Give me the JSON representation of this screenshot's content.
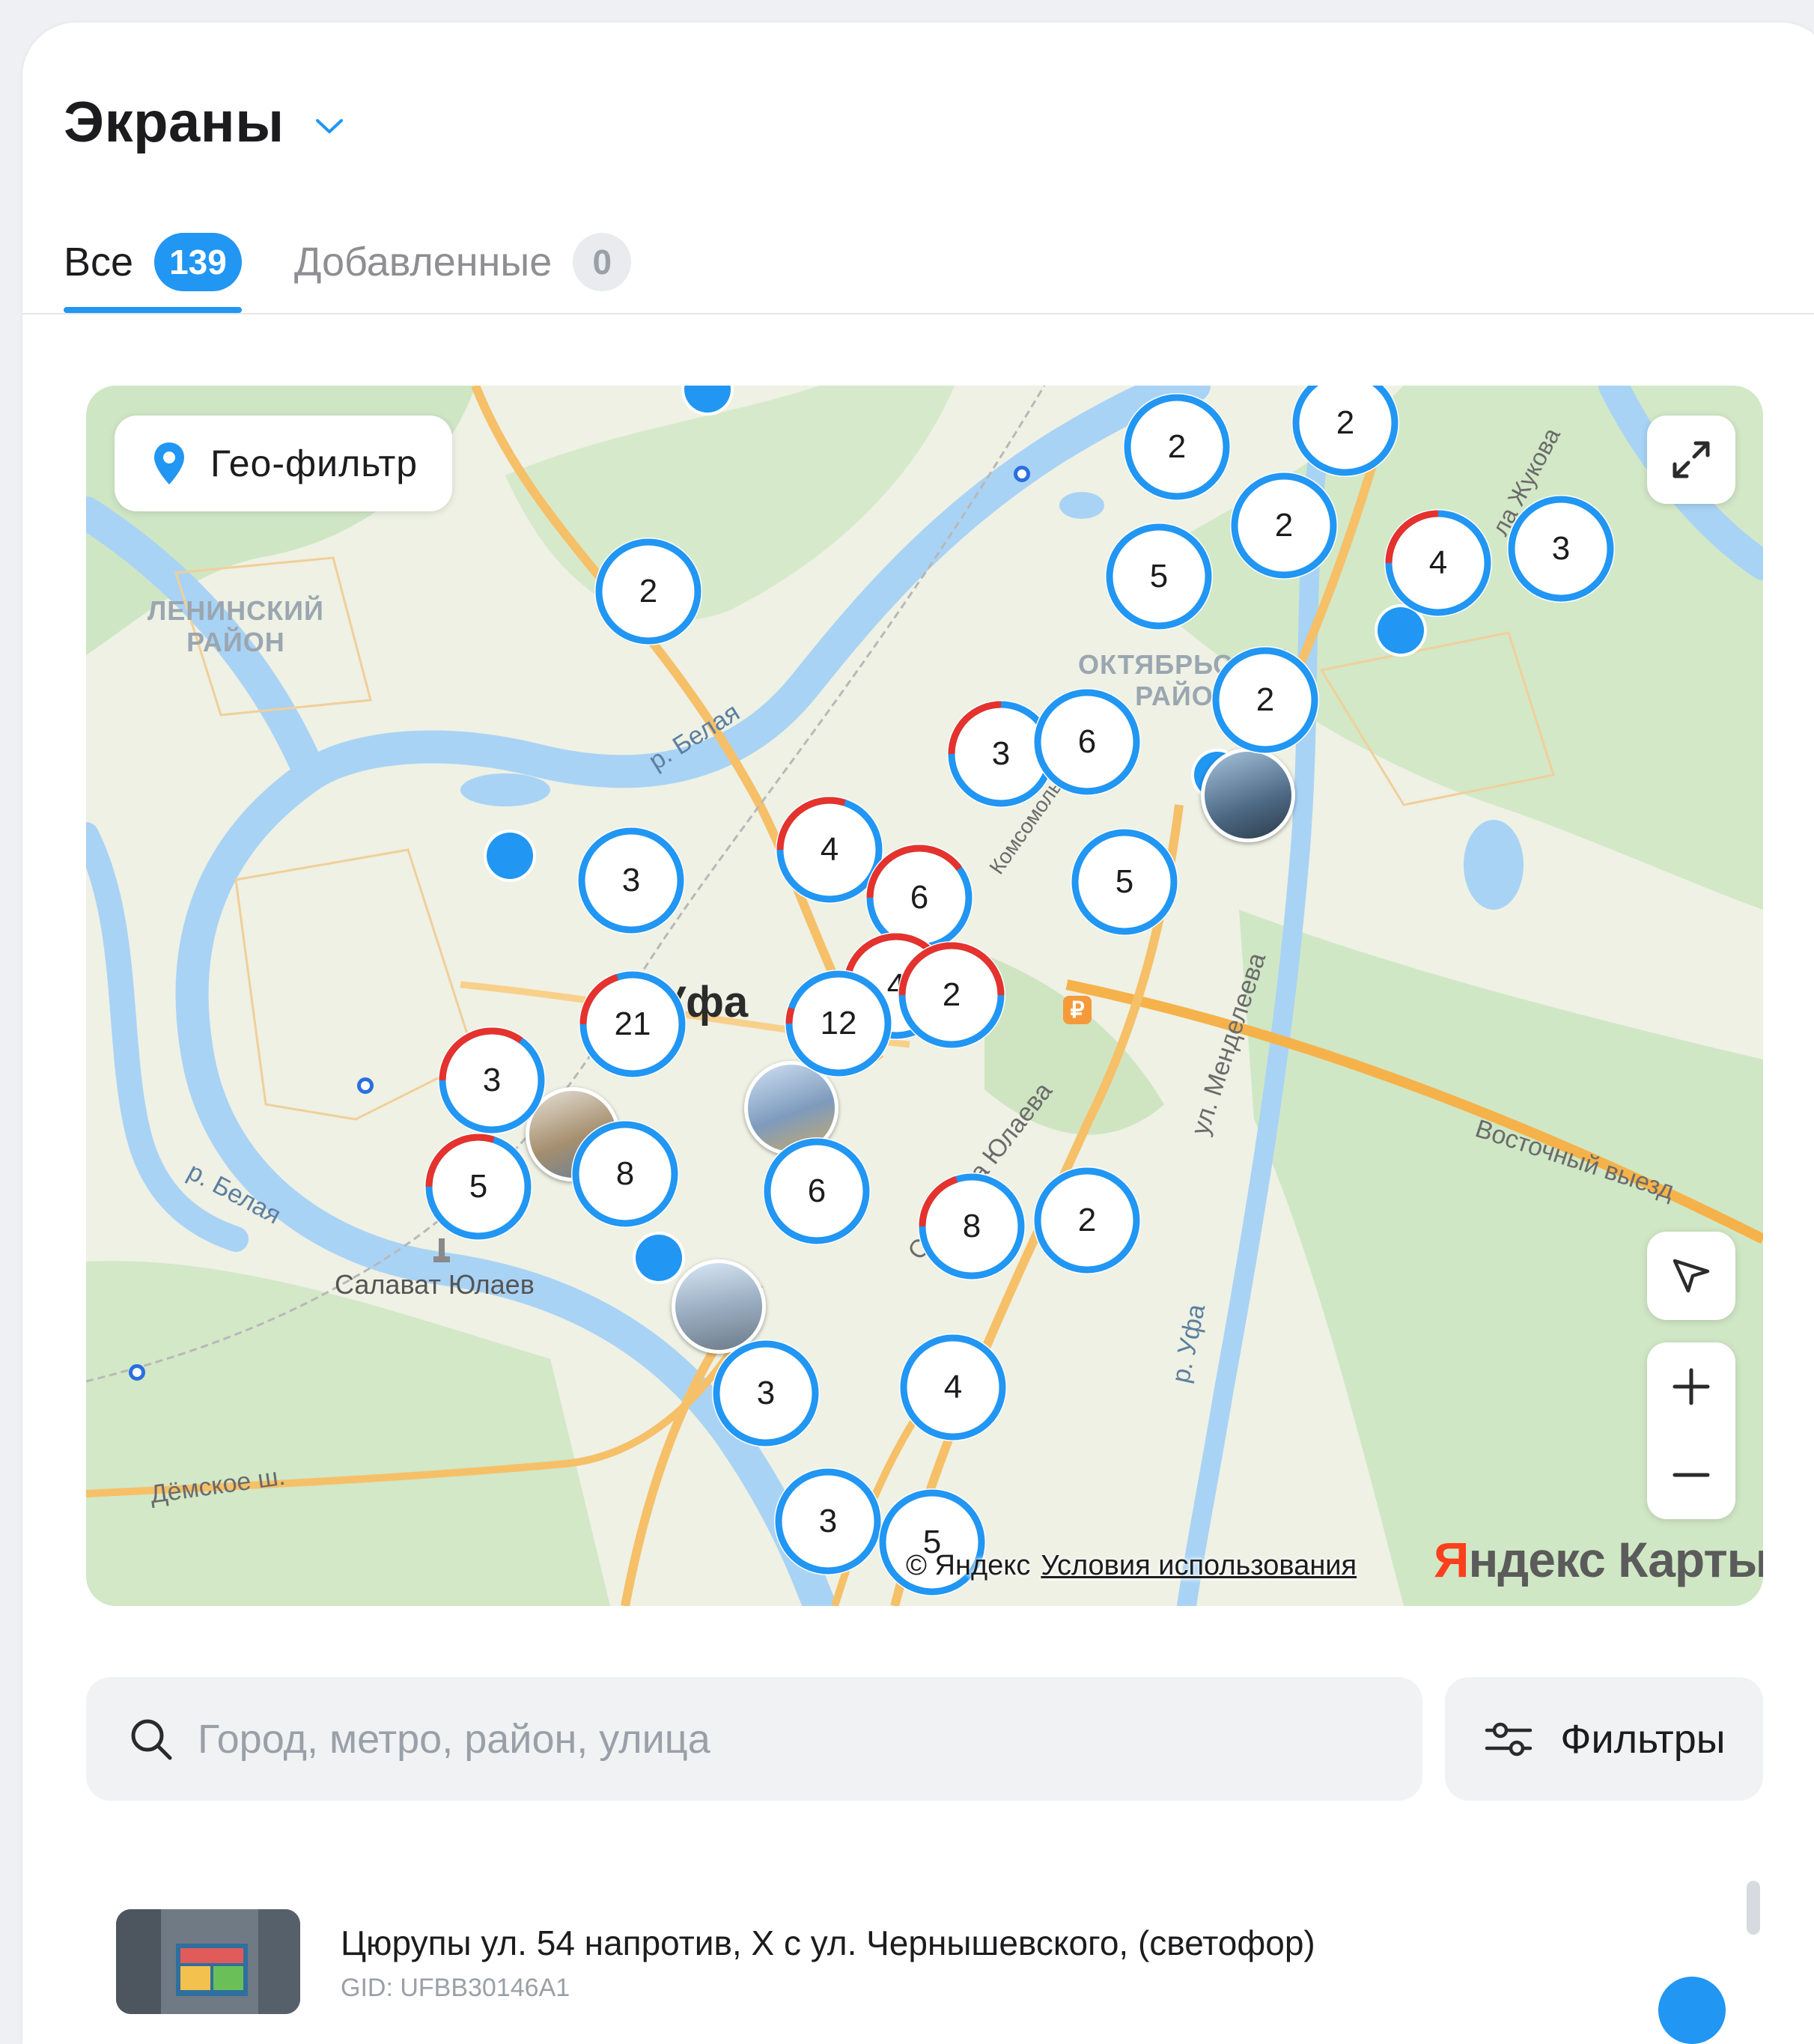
{
  "header": {
    "title": "Экраны"
  },
  "tabs": [
    {
      "label": "Все",
      "count": "139"
    },
    {
      "label": "Добавленные",
      "count": "0"
    }
  ],
  "map": {
    "geo_filter_label": "Гео-фильтр",
    "clusters": [
      "2",
      "2",
      "2",
      "5",
      "2",
      "4",
      "3",
      "2",
      "3",
      "6",
      "5",
      "3",
      "4",
      "6",
      "4",
      "2",
      "12",
      "21",
      "3",
      "5",
      "8",
      "6",
      "8",
      "2",
      "3",
      "4",
      "3",
      "5"
    ],
    "districts": {
      "leninsky": "ЛЕНИНСКИЙ\nРАЙОН",
      "oktyabrsky": "ОКТЯБРЬСКИЙ\nРАЙОН"
    },
    "labels": {
      "river_belaya_1": "р. Белая",
      "river_belaya_2": "р. Белая",
      "river_ufa": "р. Уфа",
      "city": "Уфа",
      "salavat": "Салават Юлаев",
      "street_yulaeva": "Салавата Юлаева",
      "street_mendeleeva": "ул. Менделеева",
      "vostochny": "Восточный выезд",
      "demskoe": "Дёмское ш.",
      "zhukova": "ла Жукова",
      "komsomolskaya": "Комсомольская"
    },
    "copyright": "© Яндекс",
    "terms_link": "Условия использования",
    "logo_first": "Я",
    "logo_rest": "ндекс Карты"
  },
  "search": {
    "placeholder": "Город, метро, район, улица",
    "value": ""
  },
  "filters": {
    "label": "Фильтры"
  },
  "list": {
    "items": [
      {
        "title": "Цюрупы ул. 54 напротив, X с ул. Чернышевского, (светофор)",
        "gid": "GID: UFBB30146A1"
      }
    ]
  },
  "colors": {
    "accent": "#2196f3",
    "alert": "#e5322d",
    "river": "#a9d3f5",
    "road": "#f6b24a"
  }
}
